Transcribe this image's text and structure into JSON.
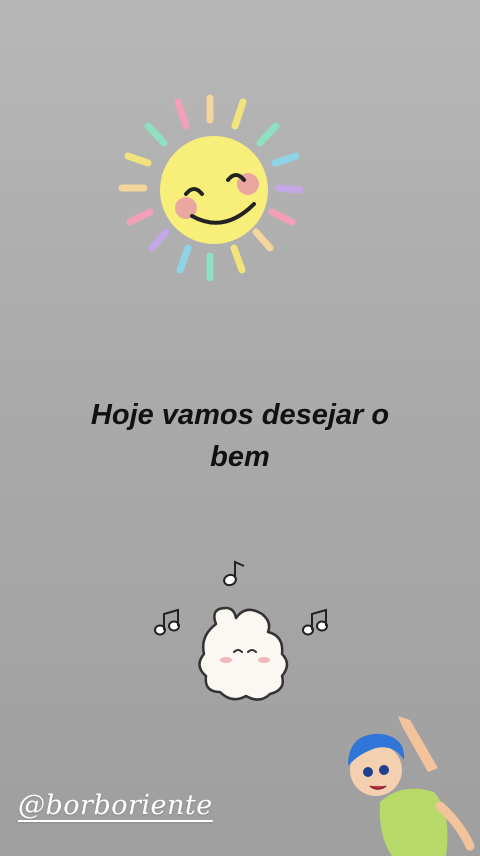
{
  "story": {
    "headline": "Hoje vamos desejar o bem",
    "handle": "@borboriente"
  },
  "stickers": [
    "smiling-sun-icon",
    "fluffy-cloud-character-icon",
    "music-note-icon",
    "joy-character-icon"
  ],
  "colors": {
    "background": "#aaaaaa",
    "sun": "#f7ef7a",
    "headline": "#111111",
    "handle": "#ffffff"
  }
}
